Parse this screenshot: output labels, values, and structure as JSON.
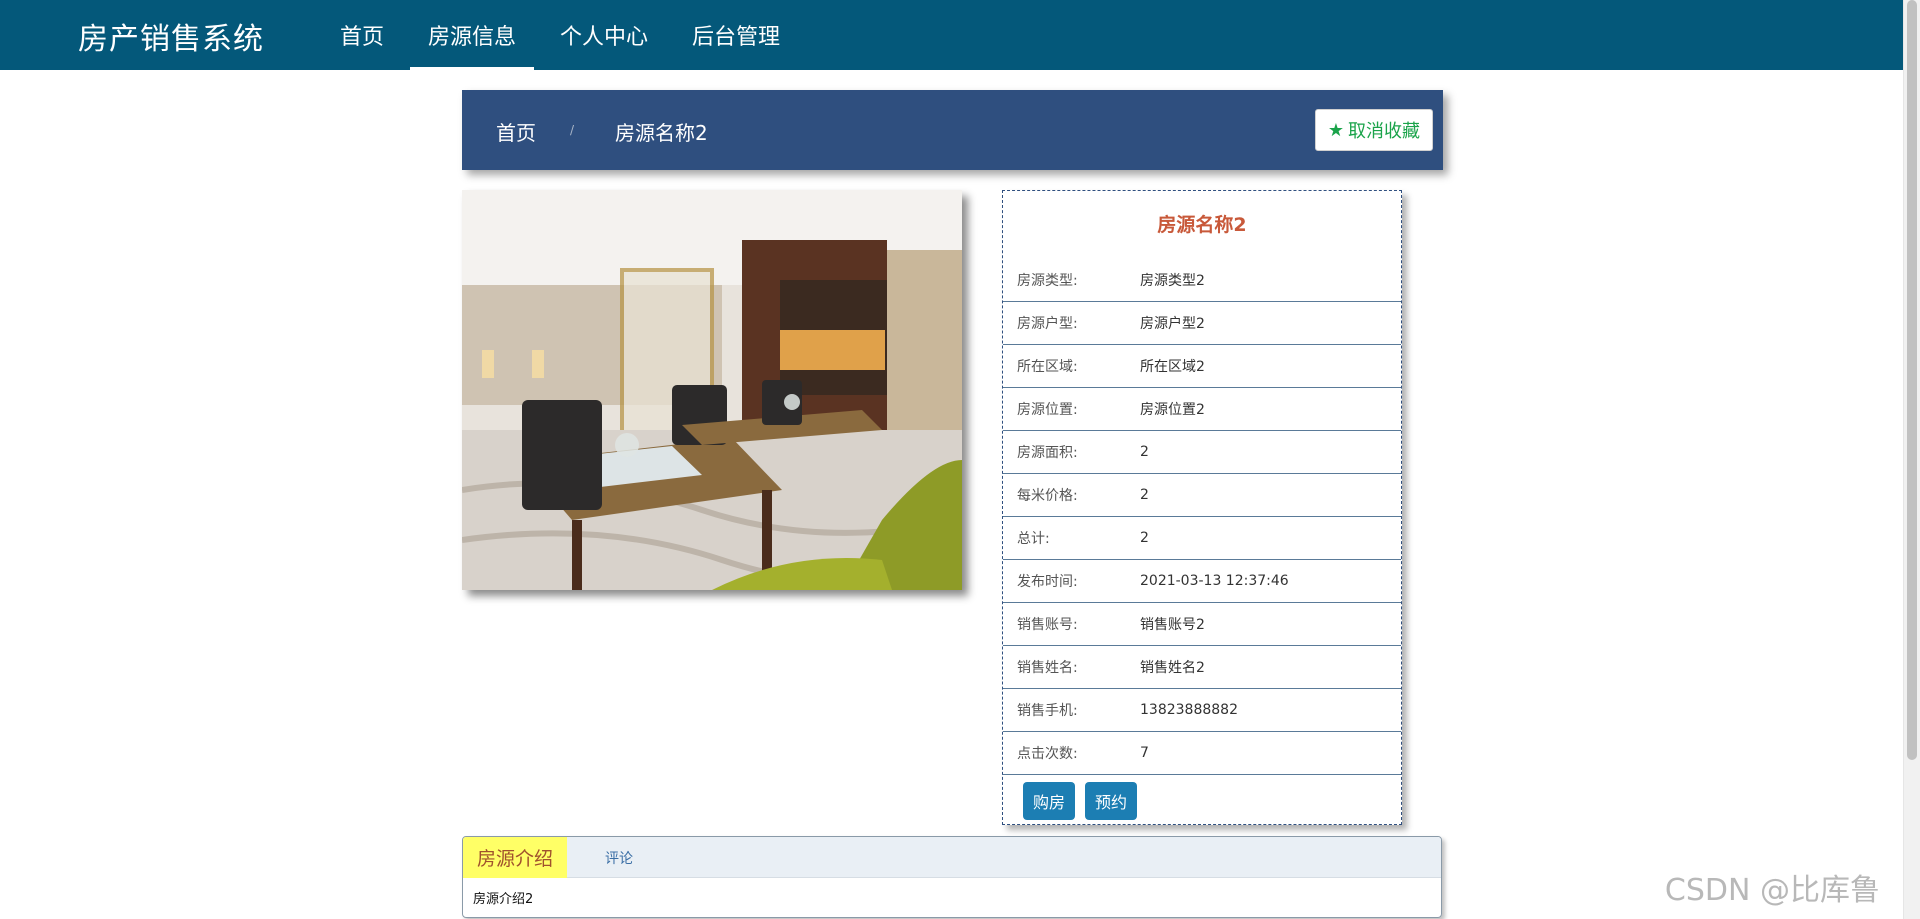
{
  "app": {
    "title": "房产销售系统"
  },
  "nav": {
    "items": [
      "首页",
      "房源信息",
      "个人中心",
      "后台管理"
    ],
    "active_index": 1
  },
  "breadcrumb": {
    "home": "首页",
    "separator": "/",
    "current": "房源名称2"
  },
  "favorite_button": {
    "icon": "star-icon",
    "label": "取消收藏"
  },
  "detail": {
    "title": "房源名称2",
    "rows": [
      {
        "label": "房源类型:",
        "value": "房源类型2"
      },
      {
        "label": "房源户型:",
        "value": "房源户型2"
      },
      {
        "label": "所在区域:",
        "value": "所在区域2"
      },
      {
        "label": "房源位置:",
        "value": "房源位置2"
      },
      {
        "label": "房源面积:",
        "value": "2"
      },
      {
        "label": "每米价格:",
        "value": "2"
      },
      {
        "label": "总计:",
        "value": "2"
      },
      {
        "label": "发布时间:",
        "value": "2021-03-13 12:37:46"
      },
      {
        "label": "销售账号:",
        "value": "销售账号2"
      },
      {
        "label": "销售姓名:",
        "value": "销售姓名2"
      },
      {
        "label": "销售手机:",
        "value": "13823888882"
      },
      {
        "label": "点击次数:",
        "value": "7"
      }
    ],
    "buttons": {
      "buy": "购房",
      "reserve": "预约"
    }
  },
  "tabs": {
    "items": [
      "房源介绍",
      "评论"
    ],
    "active_index": 0,
    "content": "房源介绍2"
  },
  "watermark": "CSDN @比库鲁",
  "colors": {
    "topbar": "#04587a",
    "breadcrumb_bar": "#2f4f7f",
    "accent_title": "#c8593a",
    "button": "#1c7eb3",
    "tab_active": "#ffff66"
  }
}
